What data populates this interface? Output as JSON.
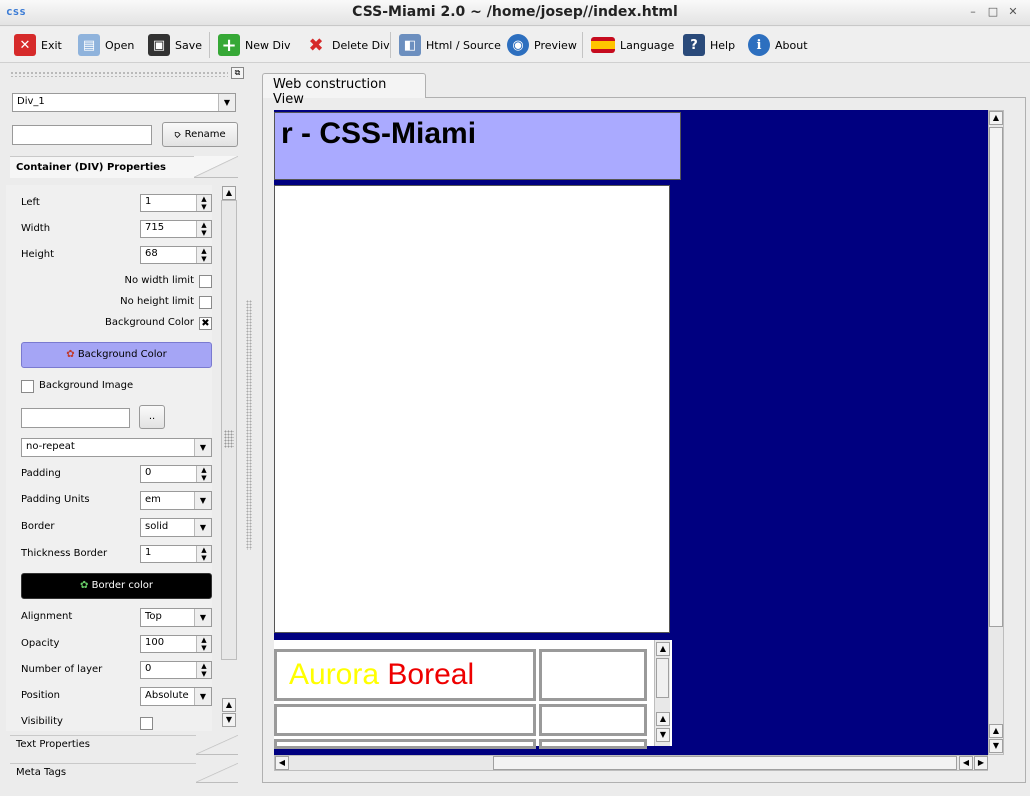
{
  "window": {
    "title": "CSS-Miami 2.0 ~ /home/josep//index.html",
    "app_icon_text": "css"
  },
  "toolbar": {
    "exit": "Exit",
    "open": "Open",
    "save": "Save",
    "new_div": "New Div",
    "delete_div": "Delete Div",
    "html_source": "Html / Source",
    "preview": "Preview",
    "language": "Language",
    "help": "Help",
    "about": "About"
  },
  "left": {
    "div_select": "Div_1",
    "rename_input": "",
    "rename_button": "Rename",
    "section_container": "Container (DIV) Properties",
    "section_text": "Text Properties",
    "section_meta": "Meta Tags",
    "props": {
      "left_label": "Left",
      "left_value": "1",
      "width_label": "Width",
      "width_value": "715",
      "height_label": "Height",
      "height_value": "68",
      "no_width_limit": "No width limit",
      "no_height_limit": "No height limit",
      "bg_color_label": "Background Color",
      "bg_color_button": "Background Color",
      "bg_image_label": "Background Image",
      "bg_image_path": "",
      "browse_button": "..",
      "repeat_value": "no-repeat",
      "padding_label": "Padding",
      "padding_value": "0",
      "padding_units_label": "Padding Units",
      "padding_units_value": "em",
      "border_label": "Border",
      "border_value": "solid",
      "thickness_label": "Thickness Border",
      "thickness_value": "1",
      "border_color_button": "Border color",
      "alignment_label": "Alignment",
      "alignment_value": "Top",
      "opacity_label": "Opacity",
      "opacity_value": "100",
      "layer_label": "Number of layer",
      "layer_value": "0",
      "position_label": "Position",
      "position_value": "Absolute",
      "visibility_label": "Visibility"
    }
  },
  "main": {
    "tab_label": "Web construction View",
    "header_text": "r - CSS-Miami",
    "aurora_word1": "Aurora",
    "aurora_word2": "Boreal"
  },
  "colors": {
    "canvas_bg": "#000080",
    "header_div_bg": "#aaaaff",
    "bg_color_button": "#a5a5f5",
    "border_color_button": "#000000",
    "aurora": "#ffff00",
    "boreal": "#ee0000"
  }
}
